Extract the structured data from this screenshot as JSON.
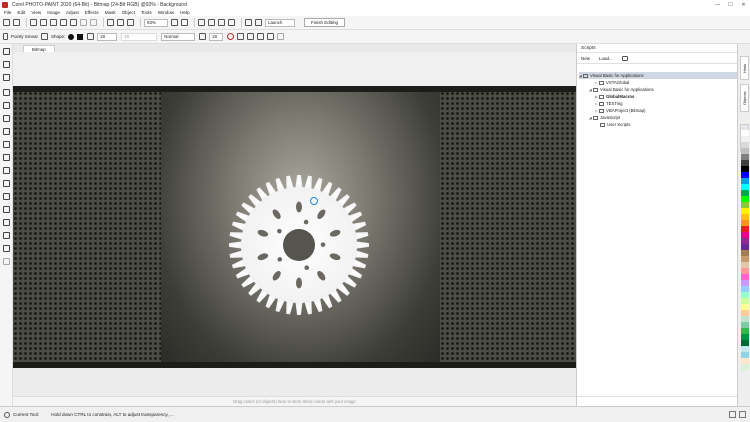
{
  "window": {
    "title": "Corel PHOTO-PAINT 2020 (64-Bit) - Bitmap (24-Bit RGB) @93% - Background",
    "minimize_glyph": "—",
    "maximize_glyph": "☐",
    "close_glyph": "✕"
  },
  "menu": [
    "File",
    "Edit",
    "View",
    "Image",
    "Adjust",
    "Effects",
    "Mask",
    "Object",
    "Tools",
    "Window",
    "Help"
  ],
  "toolbar": {
    "zoom": "93%",
    "launch": "Launch",
    "finish_editing": "Finish Editing"
  },
  "property_bar": {
    "tool_name": "Pointy Smear",
    "shape_label": "Shape:",
    "size": "20",
    "amount": "20",
    "merge_mode": "Normal",
    "transparency": "20"
  },
  "document": {
    "tab_label": "Bitmap",
    "drop_hint": "Drag colors (or objects) here to store these colors with your image"
  },
  "scripts_docker": {
    "title": "Scripts",
    "new_label": "New",
    "load_label": "Load...",
    "tree": [
      {
        "label": "Visual Basic for Applications",
        "depth": 0,
        "selected": true,
        "bold": false
      },
      {
        "label": "VSTAGlobal",
        "depth": 1,
        "selected": false,
        "bold": false
      },
      {
        "label": "Visual Basic for Applications",
        "depth": 0,
        "selected": false,
        "bold": false
      },
      {
        "label": "GlobalMacros",
        "depth": 1,
        "selected": false,
        "bold": true
      },
      {
        "label": "TESTing",
        "depth": 1,
        "selected": false,
        "bold": false
      },
      {
        "label": "VBAProject (Bitmap)",
        "depth": 1,
        "selected": false,
        "bold": false
      },
      {
        "label": "JavaScript",
        "depth": 0,
        "selected": false,
        "bold": false
      },
      {
        "label": "User Scripts",
        "depth": 1,
        "selected": false,
        "bold": false
      }
    ]
  },
  "side_tabs": [
    "Hints",
    "Objects",
    "Scripts"
  ],
  "status": {
    "tool": "Current Tool:",
    "message": "Hold down CTRL to constrain, ALT to adjust transparency, ..."
  },
  "palette_colors": [
    "#ffffff",
    "#f2f2f2",
    "#d9d9d9",
    "#bfbfbf",
    "#808080",
    "#404040",
    "#000000",
    "#0000ff",
    "#00a0e9",
    "#00ffff",
    "#00a651",
    "#00ff00",
    "#8dc63f",
    "#fff200",
    "#ffc20e",
    "#f7941d",
    "#ed1c24",
    "#ec008c",
    "#92278f",
    "#662d91",
    "#a67c52",
    "#c69c6d",
    "#e0c8a8",
    "#ff9999",
    "#ff66cc",
    "#cc99ff",
    "#99ccff",
    "#99ffcc",
    "#ccff99",
    "#ffff99",
    "#ffcc99",
    "#bfe3d0",
    "#7fcba4",
    "#39b54a",
    "#009245",
    "#006837",
    "#c4e8f0",
    "#8fd3e5",
    "#ffe6cc",
    "#d9f2d9"
  ]
}
